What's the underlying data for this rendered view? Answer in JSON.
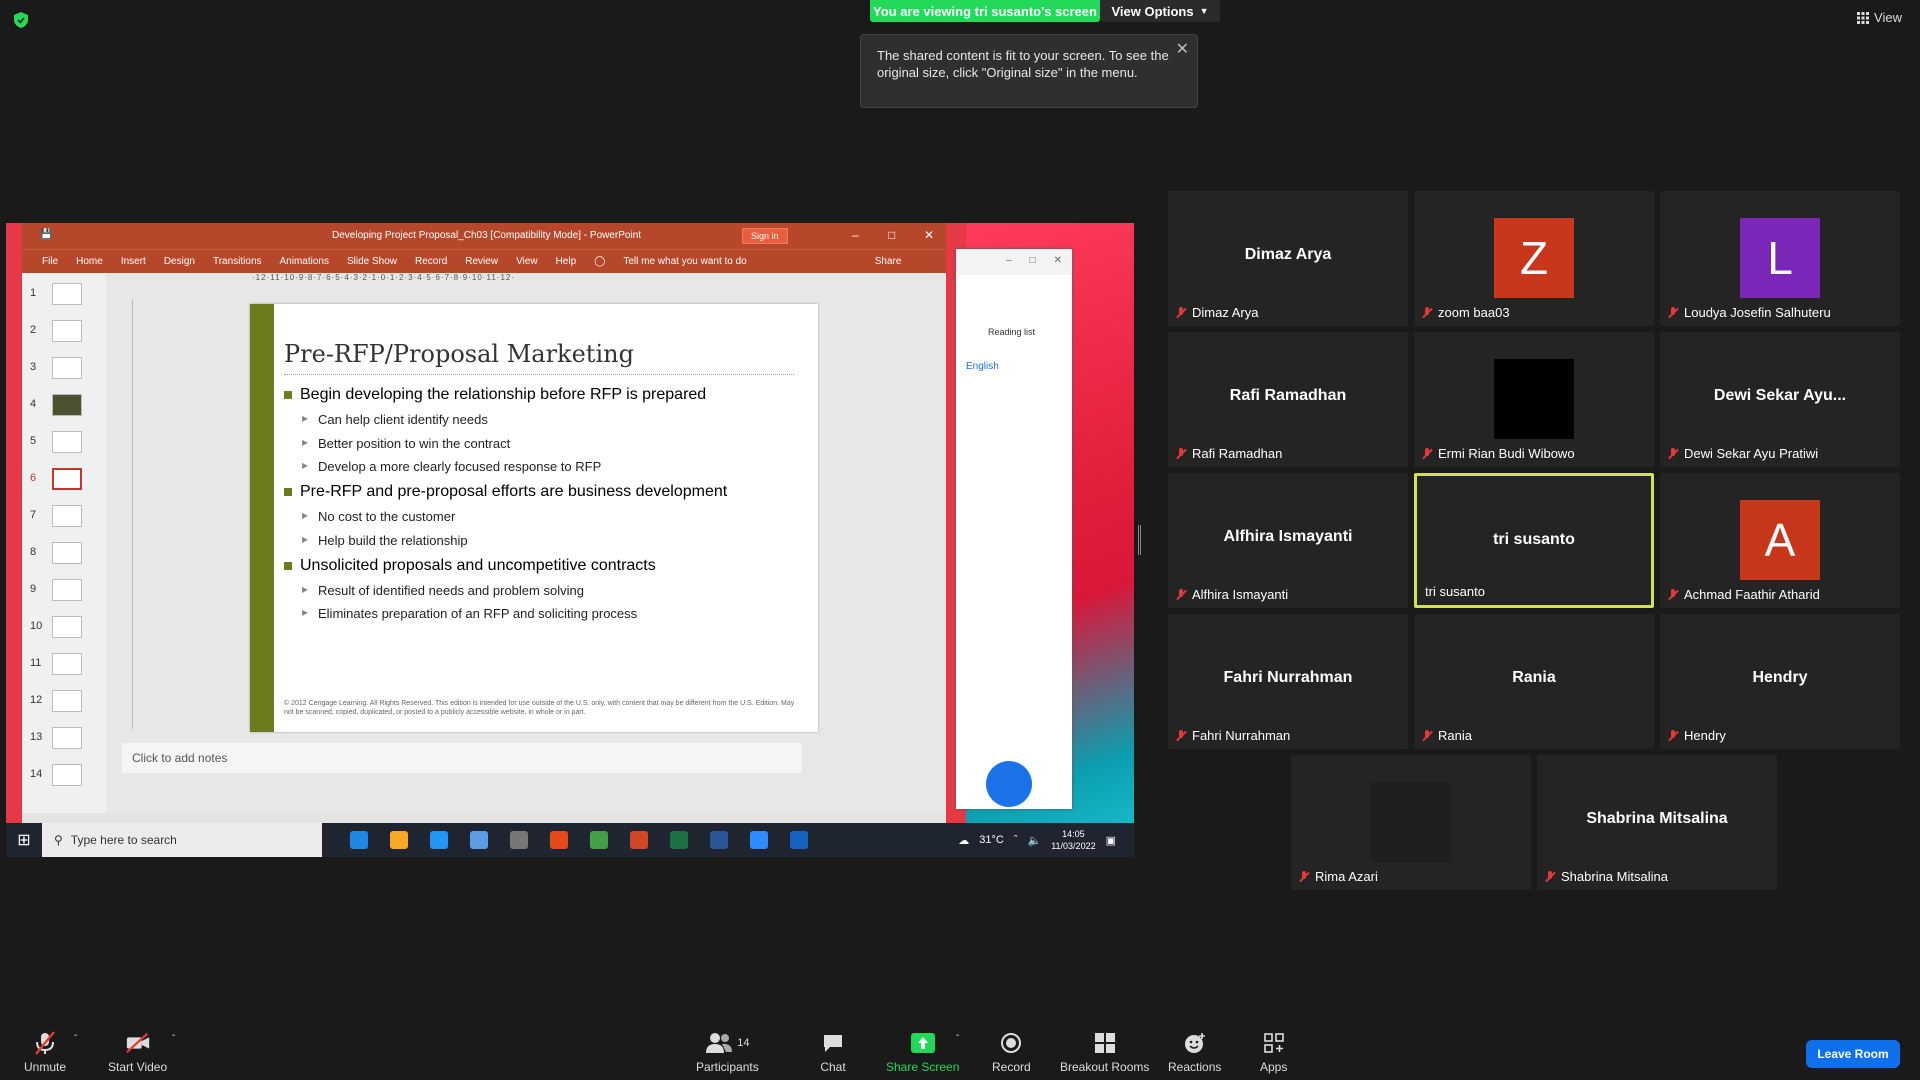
{
  "banner": {
    "viewing": "You are viewing tri susanto's screen",
    "view_options": "View Options",
    "view": "View"
  },
  "tooltip": {
    "text": "The shared content is fit to your screen. To see the original size, click \"Original size\" in the menu."
  },
  "ppt": {
    "title": "Developing Project Proposal_Ch03 [Compatibility Mode] - PowerPoint",
    "signin": "Sign in",
    "ribbon": [
      "File",
      "Home",
      "Insert",
      "Design",
      "Transitions",
      "Animations",
      "Slide Show",
      "Record",
      "Review",
      "View",
      "Help",
      "Tell me what you want to do"
    ],
    "share": "Share",
    "ruler": "·12·11·10·9·8·7·6·5·4·3·2·1·0·1·2·3·4·5·6·7·8·9·10·11·12·",
    "thumbs": [
      "1",
      "2",
      "3",
      "4",
      "5",
      "6",
      "7",
      "8",
      "9",
      "10",
      "11",
      "12",
      "13",
      "14"
    ],
    "selected_slide": "6",
    "slide": {
      "title": "Pre-RFP/Proposal Marketing",
      "b1": "Begin developing the relationship before RFP is prepared",
      "b1a": "Can help client identify needs",
      "b1b": "Better position to win the contract",
      "b1c": "Develop a more clearly focused response to RFP",
      "b2": "Pre-RFP and pre-proposal efforts are business development",
      "b2a": "No cost to the customer",
      "b2b": "Help build the relationship",
      "b3": "Unsolicited proposals and uncompetitive contracts",
      "b3a": "Result of identified needs and problem solving",
      "b3b": "Eliminates preparation of an RFP and soliciting process",
      "copyright": "© 2012 Cengage Learning. All Rights Reserved. This edition is intended for use outside of the U.S. only, with content that may be different from the U.S. Edition. May not be scanned, copied, duplicated, or posted to a publicly accessible website, in whole or in part."
    },
    "notes": "Click to add notes"
  },
  "browser": {
    "reading": "Reading list",
    "lang": "English"
  },
  "taskbar": {
    "search": "Type here to search",
    "temp": "31°C",
    "time": "14:05",
    "date": "11/03/2022"
  },
  "participants": [
    {
      "name": "Dimaz Arya",
      "label": "Dimaz Arya",
      "avatar": "",
      "avatar_color": ""
    },
    {
      "name": "",
      "label": "zoom baa03",
      "avatar": "Z",
      "avatar_color": "#c8361c"
    },
    {
      "name": "",
      "label": "Loudya Josefin Salhuteru",
      "avatar": "L",
      "avatar_color": "#7a26b8"
    },
    {
      "name": "Rafi Ramadhan",
      "label": "Rafi Ramadhan",
      "avatar": "",
      "avatar_color": ""
    },
    {
      "name": "",
      "label": "Ermi Rian Budi Wibowo",
      "avatar": "",
      "avatar_color": "#000000"
    },
    {
      "name": "Dewi Sekar Ayu...",
      "label": "Dewi Sekar Ayu Pratiwi",
      "avatar": "",
      "avatar_color": ""
    },
    {
      "name": "Alfhira Ismayanti",
      "label": "Alfhira Ismayanti",
      "avatar": "",
      "avatar_color": ""
    },
    {
      "name": "tri susanto",
      "label": "tri susanto",
      "avatar": "",
      "avatar_color": ""
    },
    {
      "name": "",
      "label": "Achmad Faathir Atharid",
      "avatar": "A",
      "avatar_color": "#c8361c"
    },
    {
      "name": "Fahri Nurrahman",
      "label": "Fahri Nurrahman",
      "avatar": "",
      "avatar_color": ""
    },
    {
      "name": "Rania",
      "label": "Rania",
      "avatar": "",
      "avatar_color": ""
    },
    {
      "name": "Hendry",
      "label": "Hendry",
      "avatar": "",
      "avatar_color": ""
    },
    {
      "name": "",
      "label": "Rima Azari",
      "avatar": "",
      "avatar_color": "#1e1e1e"
    },
    {
      "name": "Shabrina Mitsalina",
      "label": "Shabrina Mitsalina",
      "avatar": "",
      "avatar_color": ""
    }
  ],
  "toolbar": {
    "unmute": "Unmute",
    "start_video": "Start Video",
    "participants": "Participants",
    "participants_count": "14",
    "chat": "Chat",
    "share_screen": "Share Screen",
    "record": "Record",
    "breakout": "Breakout Rooms",
    "reactions": "Reactions",
    "apps": "Apps",
    "leave": "Leave Room"
  },
  "colors": {
    "active_speaker": "#d4e157",
    "share_green": "#23d959",
    "leave_blue": "#0e71eb",
    "ppt_red": "#b7472a",
    "slide_bar": "#6e7a1e"
  }
}
